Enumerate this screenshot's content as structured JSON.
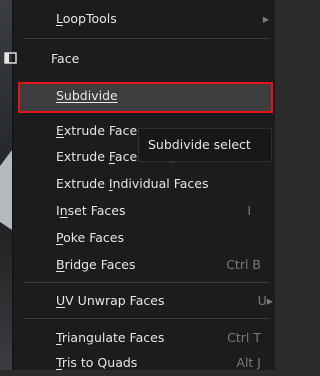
{
  "menu": {
    "top_item": {
      "label": "LoopTools",
      "has_submenu": true
    },
    "header": {
      "label": "Face",
      "icon": "face-icon"
    },
    "items": [
      {
        "label": "Subdivide",
        "shortcut": ""
      },
      {
        "label": "Extrude Face",
        "shortcut": ""
      },
      {
        "label": "Extrude Face Along Normals",
        "shortcut": ""
      },
      {
        "label": "Extrude Individual Faces",
        "shortcut": ""
      },
      {
        "label": "Inset Faces",
        "shortcut": "I"
      },
      {
        "label": "Poke Faces",
        "shortcut": ""
      },
      {
        "label": "Bridge Faces",
        "shortcut": "Ctrl B"
      },
      {
        "label": "UV Unwrap Faces",
        "shortcut": "U▸"
      },
      {
        "label": "Triangulate Faces",
        "shortcut": "Ctrl T"
      },
      {
        "label": "Tris to Quads",
        "shortcut": "Alt J"
      }
    ]
  },
  "tooltip": {
    "text": "Subdivide select"
  },
  "colors": {
    "highlight_border": "#e0141a",
    "menu_bg": "#1c1c1c"
  }
}
